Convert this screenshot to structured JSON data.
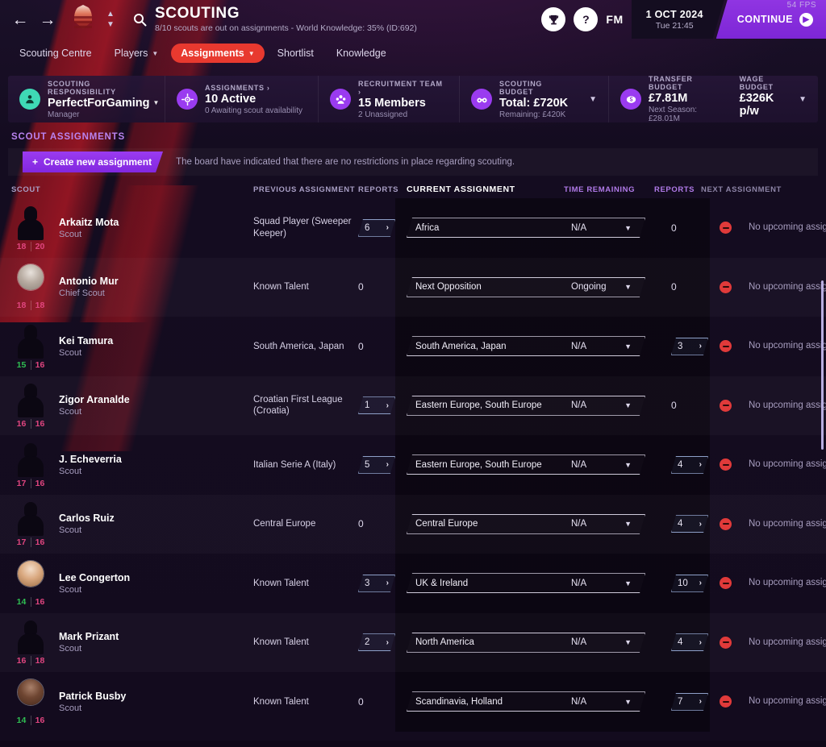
{
  "topbar": {
    "back_icon": "arrow-left",
    "forward_icon": "arrow-right",
    "title": "SCOUTING",
    "subtitle": "8/10 scouts are out on assignments - World Knowledge: 35% (ID:692)",
    "trophy_icon": "trophy-icon",
    "help_label": "?",
    "fm_label": "FM",
    "date_main": "1 OCT 2024",
    "date_sub": "Tue 21:45",
    "continue_label": "CONTINUE",
    "fps": "54 FPS"
  },
  "nav": {
    "tabs": [
      {
        "label": "Scouting Centre",
        "active": false,
        "caret": false
      },
      {
        "label": "Players",
        "active": false,
        "caret": true
      },
      {
        "label": "Assignments",
        "active": true,
        "caret": true
      },
      {
        "label": "Shortlist",
        "active": false,
        "caret": false
      },
      {
        "label": "Knowledge",
        "active": false,
        "caret": false
      }
    ]
  },
  "info": {
    "responsibility": {
      "label": "SCOUTING RESPONSIBILITY",
      "value": "PerfectForGaming",
      "sub": "Manager",
      "icon": "person-scout-icon",
      "color": "#3fd9b5"
    },
    "assignments": {
      "label": "ASSIGNMENTS",
      "arrow": "›",
      "value": "10 Active",
      "sub": "0 Awaiting scout availability",
      "icon": "target-icon",
      "color": "#9a3bf0"
    },
    "recruitment": {
      "label": "RECRUITMENT TEAM",
      "arrow": "›",
      "value": "15 Members",
      "sub": "2 Unassigned",
      "icon": "people-icon",
      "color": "#9a3bf0"
    },
    "scouting_budget": {
      "label": "SCOUTING BUDGET",
      "value": "Total: £720K",
      "sub": "Remaining: £420K",
      "icon": "binoculars-icon",
      "color": "#9a3bf0"
    },
    "transfer_budget": {
      "label": "TRANSFER BUDGET",
      "value": "£7.81M",
      "sub": "Next Season: £28.01M",
      "icon": "money-icon",
      "color": "#9a3bf0"
    },
    "wage_budget": {
      "label": "WAGE BUDGET",
      "value": "£326K p/w"
    }
  },
  "section": {
    "title": "SCOUT ASSIGNMENTS",
    "create_label": "Create new assignment",
    "create_plus": "+",
    "hint": "The board have indicated that there are no restrictions in place regarding scouting."
  },
  "table": {
    "headers": {
      "scout": "SCOUT",
      "previous": "PREVIOUS ASSIGNMENT",
      "reports1": "REPORTS",
      "current": "CURRENT ASSIGNMENT",
      "time": "TIME REMAINING",
      "reports2": "REPORTS",
      "next": "NEXT ASSIGNMENT"
    },
    "rows": [
      {
        "name": "Arkaitz Mota",
        "role": "Scout",
        "rating_left": "18",
        "rating_left_color": "pink",
        "rating_right": "20",
        "rating_right_color": "pink",
        "has_photo": false,
        "photo_tone": "",
        "previous": "Squad Player (Sweeper Keeper)",
        "prev_badge": "6",
        "prev_zero": "",
        "current": "Africa",
        "time": "N/A",
        "rep_badge": "",
        "rep_zero": "0",
        "next": "No upcoming assignment"
      },
      {
        "name": "Antonio Mur",
        "role": "Chief Scout",
        "rating_left": "18",
        "rating_left_color": "pink",
        "rating_right": "18",
        "rating_right_color": "pink",
        "has_photo": true,
        "photo_tone": "grey",
        "previous": "Known Talent",
        "prev_badge": "",
        "prev_zero": "0",
        "current": "Next Opposition",
        "time": "Ongoing",
        "rep_badge": "",
        "rep_zero": "0",
        "next": "No upcoming assignment"
      },
      {
        "name": "Kei Tamura",
        "role": "Scout",
        "rating_left": "15",
        "rating_left_color": "green",
        "rating_right": "16",
        "rating_right_color": "pink",
        "has_photo": false,
        "photo_tone": "",
        "previous": "South America, Japan",
        "prev_badge": "",
        "prev_zero": "0",
        "current": "South America, Japan",
        "time": "N/A",
        "rep_badge": "3",
        "rep_zero": "",
        "next": "No upcoming assignment"
      },
      {
        "name": "Zigor Aranalde",
        "role": "Scout",
        "rating_left": "16",
        "rating_left_color": "pink",
        "rating_right": "16",
        "rating_right_color": "pink",
        "has_photo": false,
        "photo_tone": "",
        "previous": "Croatian First League (Croatia)",
        "prev_badge": "1",
        "prev_zero": "",
        "current": "Eastern Europe, South Europe",
        "time": "N/A",
        "rep_badge": "",
        "rep_zero": "0",
        "next": "No upcoming assignment"
      },
      {
        "name": "J. Echeverria",
        "role": "Scout",
        "rating_left": "17",
        "rating_left_color": "pink",
        "rating_right": "16",
        "rating_right_color": "pink",
        "has_photo": false,
        "photo_tone": "",
        "previous": "Italian Serie A (Italy)",
        "prev_badge": "5",
        "prev_zero": "",
        "current": "Eastern Europe, South Europe",
        "time": "N/A",
        "rep_badge": "4",
        "rep_zero": "",
        "next": "No upcoming assignment"
      },
      {
        "name": "Carlos Ruiz",
        "role": "Scout",
        "rating_left": "17",
        "rating_left_color": "pink",
        "rating_right": "16",
        "rating_right_color": "pink",
        "has_photo": false,
        "photo_tone": "",
        "previous": "Central Europe",
        "prev_badge": "",
        "prev_zero": "0",
        "current": "Central Europe",
        "time": "N/A",
        "rep_badge": "4",
        "rep_zero": "",
        "next": "No upcoming assignment"
      },
      {
        "name": "Lee Congerton",
        "role": "Scout",
        "rating_left": "14",
        "rating_left_color": "green",
        "rating_right": "16",
        "rating_right_color": "pink",
        "has_photo": true,
        "photo_tone": "light",
        "previous": "Known Talent",
        "prev_badge": "3",
        "prev_zero": "",
        "current": "UK & Ireland",
        "time": "N/A",
        "rep_badge": "10",
        "rep_zero": "",
        "next": "No upcoming assignment"
      },
      {
        "name": "Mark Prizant",
        "role": "Scout",
        "rating_left": "16",
        "rating_left_color": "pink",
        "rating_right": "18",
        "rating_right_color": "pink",
        "has_photo": false,
        "photo_tone": "",
        "previous": "Known Talent",
        "prev_badge": "2",
        "prev_zero": "",
        "current": "North America",
        "time": "N/A",
        "rep_badge": "4",
        "rep_zero": "",
        "next": "No upcoming assignment"
      },
      {
        "name": "Patrick Busby",
        "role": "Scout",
        "rating_left": "14",
        "rating_left_color": "green",
        "rating_right": "16",
        "rating_right_color": "pink",
        "has_photo": true,
        "photo_tone": "dark",
        "previous": "Known Talent",
        "prev_badge": "",
        "prev_zero": "0",
        "current": "Scandinavia, Holland",
        "time": "N/A",
        "rep_badge": "7",
        "rep_zero": "",
        "next": "No upcoming assignment"
      }
    ]
  }
}
